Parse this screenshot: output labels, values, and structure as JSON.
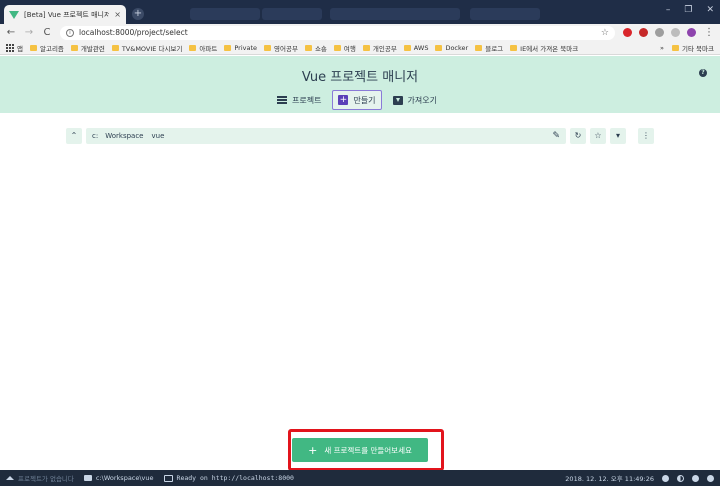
{
  "browser": {
    "tab_title": "[Beta] Vue 프로젝트 매니저 - Vu",
    "tab_close": "×",
    "new_tab": "+",
    "url": "localhost:8000/project/select",
    "nav": {
      "back": "←",
      "forward": "→",
      "reload": "C"
    },
    "bookmark_star": "☆",
    "menu": "⋮",
    "bookmarks": [
      "앱",
      "알고리즘",
      "개발관련",
      "TV&MOVIE 다시보기",
      "아파트",
      "Private",
      "영어공부",
      "쇼숑",
      "여행",
      "개인공부",
      "AWS",
      "Docker",
      "블로그",
      "IE에서 가져온 북마크"
    ],
    "bookmarks_more": "»",
    "other_bookmarks": "기타 북마크"
  },
  "app": {
    "title": "Vue 프로젝트 매니저",
    "help": "?",
    "tabs": [
      {
        "label": "프로젝트"
      },
      {
        "label": "만들기"
      },
      {
        "label": "가져오기"
      }
    ]
  },
  "pathbar": {
    "up": "⌃",
    "drive": "c:",
    "segments": [
      "Workspace",
      "vue"
    ],
    "edit": "✎",
    "refresh": "↻",
    "favorite": "☆",
    "dropdown": "▾",
    "more": "⋮"
  },
  "create_button": {
    "plus": "+",
    "label": "새 프로젝트를 만들어보세요"
  },
  "statusbar": {
    "project": "프로젝트가 없습니다",
    "cwd": "c:\\Workspace\\vue",
    "log": "Ready on http://localhost:8000",
    "datetime": "2018. 12. 12. 오후 11:49:26"
  },
  "colors": {
    "accent": "#41b883",
    "header_bg": "#cdeee0",
    "highlight": "#e2141c",
    "active_tab_border": "#8a7ad8"
  }
}
